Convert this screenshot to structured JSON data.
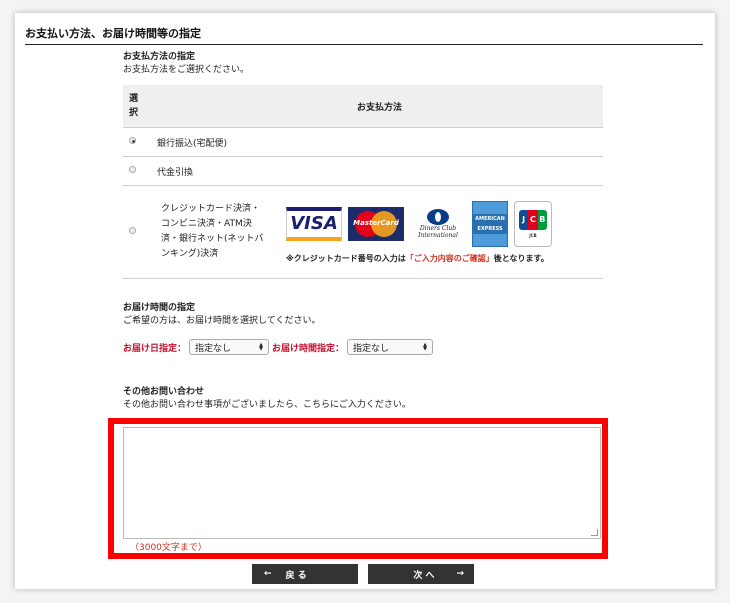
{
  "section_title": "お支払い方法、お届け時間等の指定",
  "payment": {
    "heading": "お支払方法の指定",
    "instruction": "お支払方法をご選択ください。",
    "col_select": "選択",
    "col_select_line1": "選",
    "col_select_line2": "択",
    "col_method": "お支払方法",
    "options": [
      {
        "label": "銀行振込(宅配便)",
        "selected": true
      },
      {
        "label": "代金引換",
        "selected": false
      },
      {
        "label_lines": [
          "クレジットカード決済・",
          "コンビニ決済・ATM決",
          "済・銀行ネット(ネットバ",
          "ンキング)決済"
        ],
        "selected": false
      }
    ],
    "card_logos": {
      "visa": "VISA",
      "mastercard": "MasterCard",
      "diners_1": "Diners Club",
      "diners_2": "International",
      "amex_1": "AMERICAN",
      "amex_2": "EXPRESS",
      "jcb": "JCB",
      "jcb_j": "J",
      "jcb_c": "C",
      "jcb_b": "B"
    },
    "card_note_pre": "※クレジットカード番号の入力は",
    "card_note_highlight": "「ご入力内容のご確認」",
    "card_note_post": "後となります。"
  },
  "delivery": {
    "heading": "お届け時間の指定",
    "instruction": "ご希望の方は、お届け時間を選択してください。",
    "date_label": "お届け日指定：",
    "date_value": "指定なし",
    "time_label": "お届け時間指定：",
    "time_value": "指定なし"
  },
  "inquiry": {
    "heading": "その他お問い合わせ",
    "instruction": "その他お問い合わせ事項がございましたら、こちらにご入力ください。",
    "limit_note": "（3000文字まで）",
    "value": ""
  },
  "buttons": {
    "back_arrow": "←",
    "back_label": "戻 る",
    "next_label": "次 へ",
    "next_arrow": "→"
  },
  "colors": {
    "highlight": "#ff0000",
    "red_label": "#c8102e",
    "button_bg": "#333333"
  }
}
